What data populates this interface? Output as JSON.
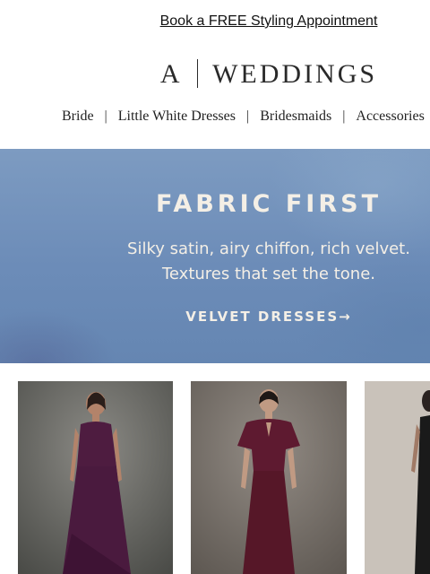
{
  "promo": {
    "link_text": "Book a FREE Styling Appointment"
  },
  "brand": {
    "logo_left": "A",
    "logo_right": "WEDDINGS"
  },
  "nav": {
    "items": [
      "Bride",
      "Little White Dresses",
      "Bridesmaids",
      "Accessories"
    ]
  },
  "hero": {
    "title": "FABRIC FIRST",
    "subtitle_line1": "Silky satin, airy chiffon, rich velvet.",
    "subtitle_line2": "Textures that set the tone.",
    "cta": "VELVET DRESSES→"
  },
  "colors": {
    "hero_bg": "#6f8fba",
    "hero_text": "#f4efe6",
    "dress_plum": "#4e1c40",
    "dress_burgundy": "#5e1a30",
    "dress_black": "#1a1a1a"
  },
  "products": [
    {
      "image": "plum-cowl-neck-midi-dress-photo"
    },
    {
      "image": "burgundy-velvet-flutter-sleeve-dress-photo"
    },
    {
      "image": "black-dress-photo"
    }
  ]
}
